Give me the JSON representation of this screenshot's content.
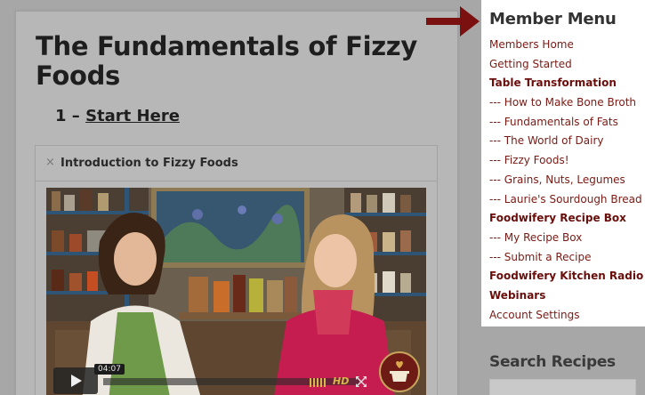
{
  "main": {
    "page_title": "The Fundamentals of Fizzy Foods",
    "section_number": "1 –",
    "section_link": "Start Here",
    "lesson": {
      "close_symbol": "×",
      "title": "Introduction to Fizzy Foods"
    },
    "video": {
      "time": "04:07",
      "hd_label": "HD"
    }
  },
  "sidebar": {
    "menu_title": "Member Menu",
    "items": [
      {
        "label": "Members Home",
        "bold": false
      },
      {
        "label": "Getting Started",
        "bold": false
      },
      {
        "label": "Table Transformation",
        "bold": true
      },
      {
        "label": "--- How to Make Bone Broth",
        "bold": false
      },
      {
        "label": "--- Fundamentals of Fats",
        "bold": false
      },
      {
        "label": "--- The World of Dairy",
        "bold": false
      },
      {
        "label": "--- Fizzy Foods!",
        "bold": false
      },
      {
        "label": "--- Grains, Nuts, Legumes",
        "bold": false
      },
      {
        "label": "--- Laurie's Sourdough Bread",
        "bold": false
      },
      {
        "label": "Foodwifery Recipe Box",
        "bold": true
      },
      {
        "label": "--- My Recipe Box",
        "bold": false
      },
      {
        "label": "--- Submit a Recipe",
        "bold": false
      },
      {
        "label": "Foodwifery Kitchen Radio",
        "bold": true
      },
      {
        "label": "Webinars",
        "bold": true
      },
      {
        "label": "Account Settings",
        "bold": false
      }
    ],
    "search_heading": "Search Recipes"
  },
  "colors": {
    "menu_link": "#7a1a14",
    "arrow": "#7b1010",
    "overlay_gray": "#a7a7a7"
  },
  "icons": [
    "arrow-right-icon",
    "close-icon",
    "play-icon",
    "volume-icon",
    "fullscreen-icon",
    "pot-logo-icon"
  ]
}
